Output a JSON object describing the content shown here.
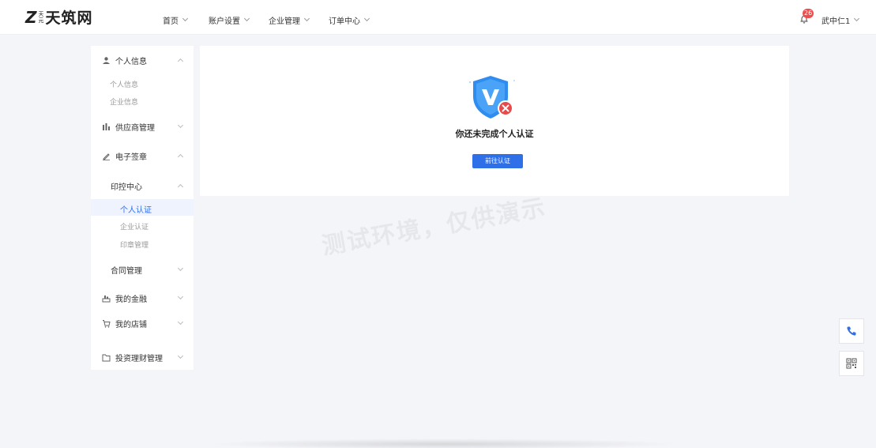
{
  "header": {
    "logo_mark": "Z",
    "logo_small_top": "天",
    "logo_small_bottom": "元",
    "logo_text": "天筑网",
    "nav": [
      "首页",
      "账户设置",
      "企业管理",
      "订单中心"
    ],
    "notification_count": "26",
    "user_name": "武中仁1"
  },
  "sidebar": {
    "personal_info": "个人信息",
    "personal_info_sub": [
      "个人信息",
      "企业信息"
    ],
    "supplier": "供应商管理",
    "esign": "电子签章",
    "seal_center": "印控中心",
    "seal_center_sub": [
      "个人认证",
      "企业认证",
      "印章管理"
    ],
    "contract": "合同管理",
    "finance": "我的金融",
    "shop": "我的店铺",
    "invest": "投资理财管理"
  },
  "main": {
    "message": "你还未完成个人认证",
    "button": "前往认证"
  },
  "watermark": "测试环境，仅供演示",
  "colors": {
    "accent": "#2f6fe8",
    "badge": "#f04c4c",
    "shield": "#2f8df0",
    "error": "#e84a4a"
  },
  "icons": [
    "bell-icon",
    "phone-icon",
    "qrcode-icon",
    "shield-v-icon",
    "user-icon",
    "chart-icon",
    "pen-icon",
    "coin-icon",
    "cart-icon",
    "folder-icon"
  ]
}
